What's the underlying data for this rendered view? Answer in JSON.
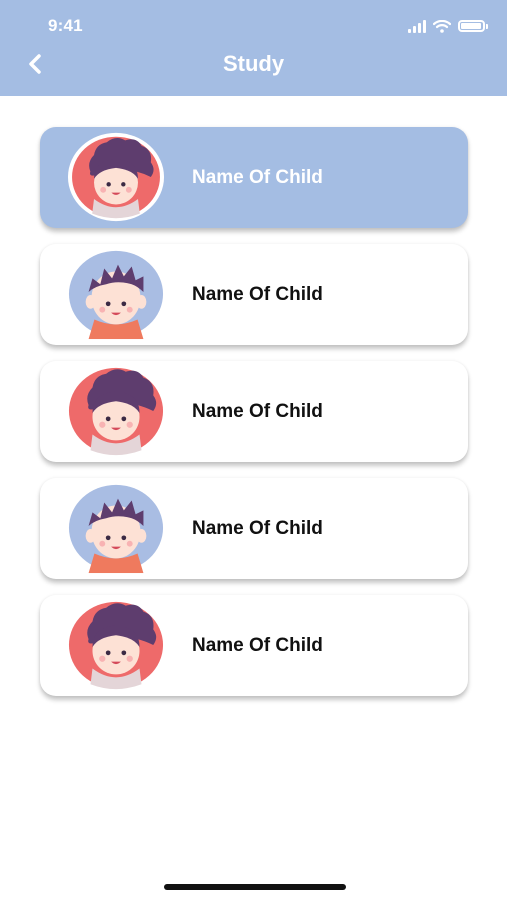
{
  "status_bar": {
    "time": "9:41"
  },
  "header": {
    "title": "Study"
  },
  "children": [
    {
      "name": "Name Of Child",
      "avatar": "girl-avatar-icon",
      "avatar_bg": "#ee6a6a",
      "selected": true
    },
    {
      "name": "Name Of Child",
      "avatar": "boy-avatar-icon",
      "avatar_bg": "#a9bde3",
      "selected": false
    },
    {
      "name": "Name Of Child",
      "avatar": "girl-avatar-icon",
      "avatar_bg": "#ee6a6a",
      "selected": false
    },
    {
      "name": "Name Of Child",
      "avatar": "boy-avatar-icon",
      "avatar_bg": "#a9bde3",
      "selected": false
    },
    {
      "name": "Name Of Child",
      "avatar": "girl-avatar-icon",
      "avatar_bg": "#ee6a6a",
      "selected": false
    }
  ],
  "colors": {
    "header_bg": "#a4bde3",
    "selected_card": "#a4bde3",
    "hair": "#5e3d6e",
    "skin": "#fde1d5"
  }
}
